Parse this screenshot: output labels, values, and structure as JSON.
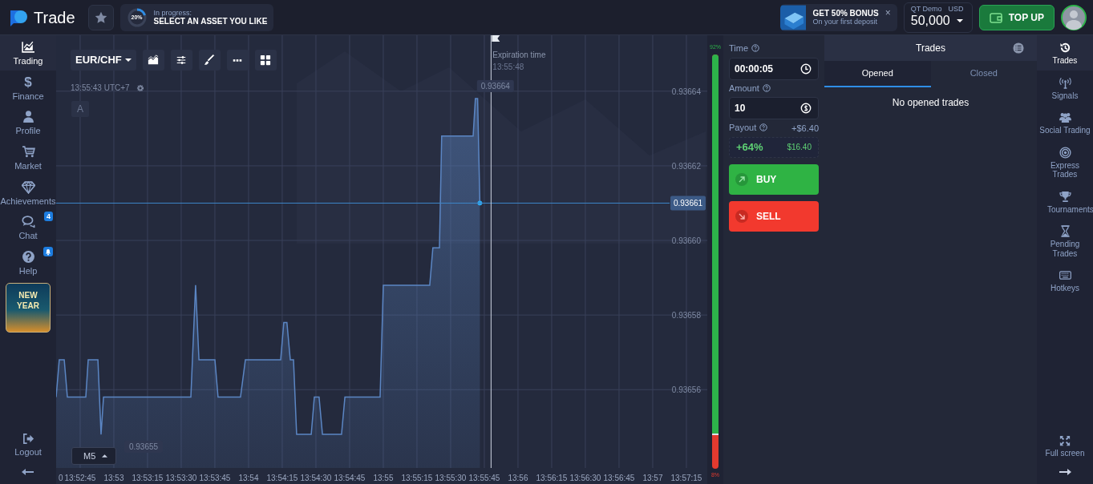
{
  "header": {
    "logo_text": "Trade",
    "progress": {
      "percent": "20%",
      "level": 0.2,
      "label": "In progress:",
      "task": "SELECT AN ASSET YOU LIKE"
    },
    "bonus": {
      "title": "GET 50% BONUS",
      "subtitle": "On your first deposit",
      "close": "×"
    },
    "account": {
      "label": "QT Demo",
      "currency": "USD",
      "balance": "50,000"
    },
    "top_up": "TOP UP"
  },
  "left_sidebar": {
    "items": [
      {
        "label": "Trading",
        "selected": true
      },
      {
        "label": "Finance",
        "glyph": "$",
        "selected": false
      },
      {
        "label": "Profile",
        "selected": false
      },
      {
        "label": "Market",
        "selected": false
      },
      {
        "label": "Achievements",
        "selected": false
      },
      {
        "label": "Chat",
        "badge": "4",
        "selected": false
      },
      {
        "label": "Help",
        "selected": false
      }
    ],
    "promo": "NEW YEAR",
    "logout": "Logout"
  },
  "chart": {
    "clock": "13:55:43 UTC+7",
    "marker_button": "A",
    "expiration_time": "13:55:48",
    "cut_axis_label": "0",
    "max_label": "0.93664",
    "min_label": "0.93655",
    "timeframe": "M5",
    "chart_data": {
      "type": "area",
      "x": [
        49954.3,
        49955.7,
        49957.9,
        49959.3,
        49967.5,
        49968.6,
        49972.9,
        49974.3,
        49975.4,
        50014.3,
        50016.4,
        50017.9,
        50025,
        50026.4,
        50036.4,
        50038.6,
        50054.3,
        50055.7,
        50057.1,
        50058.6,
        50060,
        50061.4,
        50067.9,
        50069.3,
        50071.4,
        50072.9,
        50081.4,
        50082.9,
        50098.6,
        50100,
        50120.7,
        50122.1,
        50125,
        50126,
        50140,
        50141,
        50142,
        50143
      ],
      "series": [
        {
          "name": "EUR/CHF",
          "color": "#5b86c4",
          "values": [
            0.936558,
            0.936568,
            0.936568,
            0.936558,
            0.936558,
            0.936568,
            0.936568,
            0.936548,
            0.936558,
            0.936558,
            0.936588,
            0.936568,
            0.936568,
            0.936558,
            0.936558,
            0.936568,
            0.936568,
            0.936578,
            0.936578,
            0.936568,
            0.936568,
            0.936548,
            0.936548,
            0.936558,
            0.936558,
            0.936548,
            0.936548,
            0.936558,
            0.936558,
            0.936588,
            0.936588,
            0.936598,
            0.936598,
            0.936628,
            0.936628,
            0.936638,
            0.936638,
            0.93661
          ]
        }
      ],
      "xlim": [
        49954.3,
        50244.3
      ],
      "ylim": [
        0.936539,
        0.936655
      ],
      "xticks": [
        {
          "value": 49965,
          "label": "13:52:45"
        },
        {
          "value": 49980,
          "label": "13:53"
        },
        {
          "value": 49995,
          "label": "13:53:15"
        },
        {
          "value": 50010,
          "label": "13:53:30"
        },
        {
          "value": 50025,
          "label": "13:53:45"
        },
        {
          "value": 50040,
          "label": "13:54"
        },
        {
          "value": 50055,
          "label": "13:54:15"
        },
        {
          "value": 50070,
          "label": "13:54:30"
        },
        {
          "value": 50085,
          "label": "13:54:45"
        },
        {
          "value": 50100,
          "label": "13:55"
        },
        {
          "value": 50115,
          "label": "13:55:15"
        },
        {
          "value": 50130,
          "label": "13:55:30"
        },
        {
          "value": 50145,
          "label": "13:55:45"
        },
        {
          "value": 50160,
          "label": "13:56"
        },
        {
          "value": 50175,
          "label": "13:56:15"
        },
        {
          "value": 50190,
          "label": "13:56:30"
        },
        {
          "value": 50205,
          "label": "13:56:45"
        },
        {
          "value": 50220,
          "label": "13:57"
        },
        {
          "value": 50235,
          "label": "13:57:15"
        }
      ],
      "yticks": [
        {
          "value": 0.93664,
          "label": "0.93664"
        },
        {
          "value": 0.93662,
          "label": "0.93662"
        },
        {
          "value": 0.9366,
          "label": "0.93660"
        },
        {
          "value": 0.93658,
          "label": "0.93658"
        },
        {
          "value": 0.93656,
          "label": "0.93656"
        }
      ],
      "grid": true,
      "ref_lines": [
        {
          "axis": "y",
          "value": 0.93661,
          "label": "0.93661"
        },
        {
          "axis": "x",
          "value": 50148,
          "label": "Expiration time"
        }
      ]
    }
  },
  "sentiment": {
    "up": "92%",
    "down": "8%",
    "level": 0.92
  },
  "trade_panel": {
    "time_label": "Time",
    "time_value": "00:00:05",
    "amount_label": "Amount",
    "amount_value": "10",
    "payout_label": "Payout",
    "payout_amount": "+$6.40",
    "payout_percent": "+64%",
    "payout_total": "$16.40",
    "buy": "BUY",
    "sell": "SELL"
  },
  "trades_panel": {
    "title": "Trades",
    "tabs": [
      {
        "label": "Opened",
        "selected": true
      },
      {
        "label": "Closed",
        "selected": false
      }
    ],
    "empty": "No opened trades"
  },
  "right_sidebar": {
    "items": [
      {
        "label": "Trades",
        "selected": true
      },
      {
        "label": "Signals",
        "selected": false
      },
      {
        "label": "Social Trading",
        "selected": false
      },
      {
        "label": "Express Trades",
        "selected": false
      },
      {
        "label": "Tournaments",
        "selected": false
      },
      {
        "label": "Pending Trades",
        "selected": false
      },
      {
        "label": "Hotkeys",
        "selected": false
      }
    ],
    "full_screen": "Full screen"
  }
}
